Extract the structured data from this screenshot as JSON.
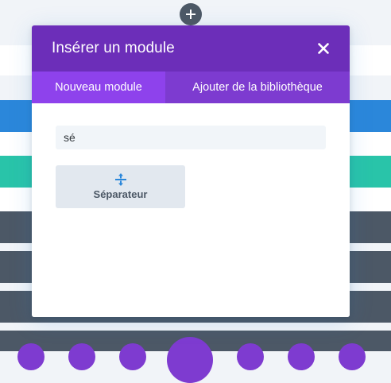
{
  "modal": {
    "title": "Insérer un module",
    "close_icon": "close-icon"
  },
  "tabs": [
    {
      "label": "Nouveau module",
      "active": true
    },
    {
      "label": "Ajouter de la bibliothèque",
      "active": false
    }
  ],
  "search": {
    "value": "sé",
    "placeholder": ""
  },
  "results": [
    {
      "label": "Séparateur",
      "icon": "divider-move-icon"
    }
  ],
  "colors": {
    "header": "#6c2eb9",
    "tab_active": "#8e42ec",
    "tab_inactive": "#7d3bd0",
    "accent_blue": "#2b87da",
    "accent_teal": "#29c4a9",
    "row_dark": "#4c5866"
  }
}
